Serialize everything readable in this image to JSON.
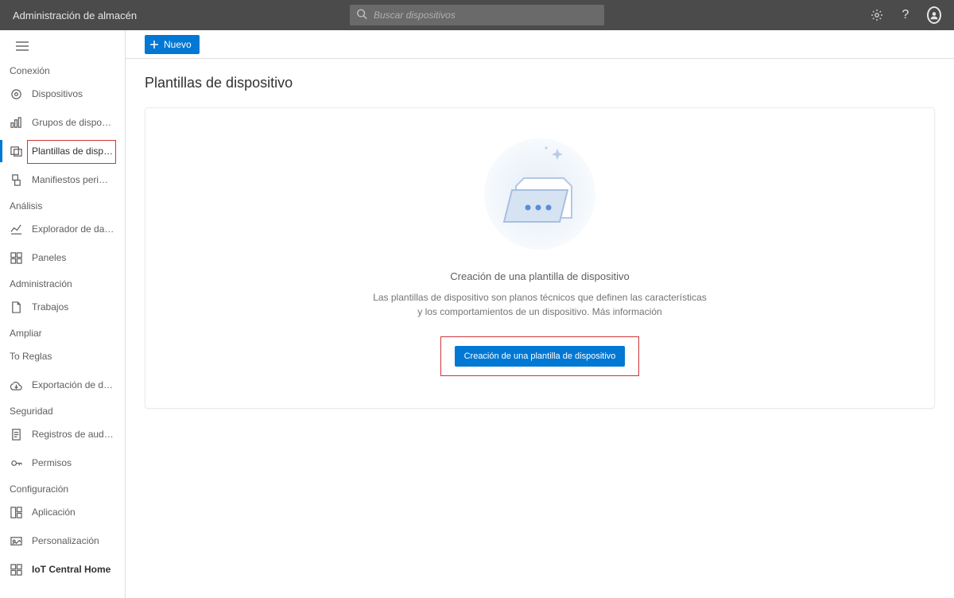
{
  "header": {
    "app_title": "Administración de almacén",
    "search_placeholder": "Buscar dispositivos"
  },
  "toolbar": {
    "new_label": "Nuevo"
  },
  "page": {
    "title": "Plantillas de dispositivo"
  },
  "empty_state": {
    "title": "Creación de una plantilla de dispositivo",
    "desc_line1": "Las plantillas de dispositivo son planos técnicos que definen las características",
    "desc_line2_prefix": "y los comportamientos de un dispositivo. ",
    "more_info": "Más información",
    "cta": "Creación de una plantilla de dispositivo"
  },
  "sidebar": {
    "sections": [
      {
        "header": "Conexión",
        "items": [
          {
            "label": "Dispositivos",
            "icon": "devices"
          },
          {
            "label": "Grupos de dispositivos",
            "icon": "groups"
          },
          {
            "label": "Plantillas de dispositivo",
            "icon": "templates",
            "active": true
          },
          {
            "label": "Manifiestos perimetrales",
            "icon": "manifest"
          }
        ]
      },
      {
        "header": "Análisis",
        "items": [
          {
            "label": "Explorador de datos",
            "icon": "explorer"
          },
          {
            "label": "Paneles",
            "icon": "dashboard"
          }
        ]
      },
      {
        "header": "Administración",
        "items": [
          {
            "label": "Trabajos",
            "icon": "jobs"
          }
        ]
      },
      {
        "header": "Ampliar",
        "items": [
          {
            "label": "To Reglas",
            "icon": "none"
          },
          {
            "label": "Exportación de datos",
            "icon": "export"
          }
        ]
      },
      {
        "header": "Seguridad",
        "items": [
          {
            "label": "Registros de auditoría",
            "icon": "audit"
          },
          {
            "label": "Permisos",
            "icon": "permissions"
          }
        ]
      },
      {
        "header": "Configuración",
        "items": [
          {
            "label": "Aplicación",
            "icon": "app"
          },
          {
            "label": "Personalización",
            "icon": "personalize"
          },
          {
            "label": "IoT Central Home",
            "icon": "home"
          }
        ]
      }
    ]
  }
}
